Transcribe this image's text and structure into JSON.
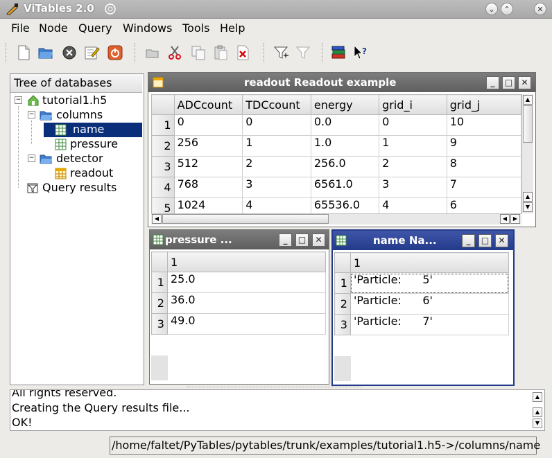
{
  "window": {
    "title": "ViTables 2.0"
  },
  "menu": [
    "File",
    "Node",
    "Query",
    "Windows",
    "Tools",
    "Help"
  ],
  "tree": {
    "header": "Tree of databases",
    "items": [
      {
        "label": "tutorial1.h5"
      },
      {
        "label": "columns"
      },
      {
        "label": "name"
      },
      {
        "label": "pressure"
      },
      {
        "label": "detector"
      },
      {
        "label": "readout"
      },
      {
        "label": "Query results"
      }
    ]
  },
  "readout": {
    "title": "readout Readout example",
    "columns": [
      "ADCcount",
      "TDCcount",
      "energy",
      "grid_i",
      "grid_j"
    ],
    "rows": [
      {
        "n": "1",
        "cells": [
          "0",
          "0",
          "0.0",
          "0",
          "10"
        ]
      },
      {
        "n": "2",
        "cells": [
          "256",
          "1",
          "1.0",
          "1",
          "9"
        ]
      },
      {
        "n": "3",
        "cells": [
          "512",
          "2",
          "256.0",
          "2",
          "8"
        ]
      },
      {
        "n": "4",
        "cells": [
          "768",
          "3",
          "6561.0",
          "3",
          "7"
        ]
      },
      {
        "n": "5",
        "cells": [
          "1024",
          "4",
          "65536.0",
          "4",
          "6"
        ]
      }
    ]
  },
  "pressure": {
    "title": "pressure ...",
    "column": "1",
    "rows": [
      {
        "n": "1",
        "v": "25.0"
      },
      {
        "n": "2",
        "v": "36.0"
      },
      {
        "n": "3",
        "v": "49.0"
      }
    ]
  },
  "name": {
    "title": "name Na...",
    "column": "1",
    "rows": [
      {
        "n": "1",
        "v": "'Particle:      5'"
      },
      {
        "n": "2",
        "v": "'Particle:      6'"
      },
      {
        "n": "3",
        "v": "'Particle:      7'"
      }
    ]
  },
  "log": [
    "All rights reserved.",
    "Creating the Query results file...",
    "OK!"
  ],
  "status": "/home/faltet/PyTables/pytables/trunk/examples/tutorial1.h5->/columns/name"
}
